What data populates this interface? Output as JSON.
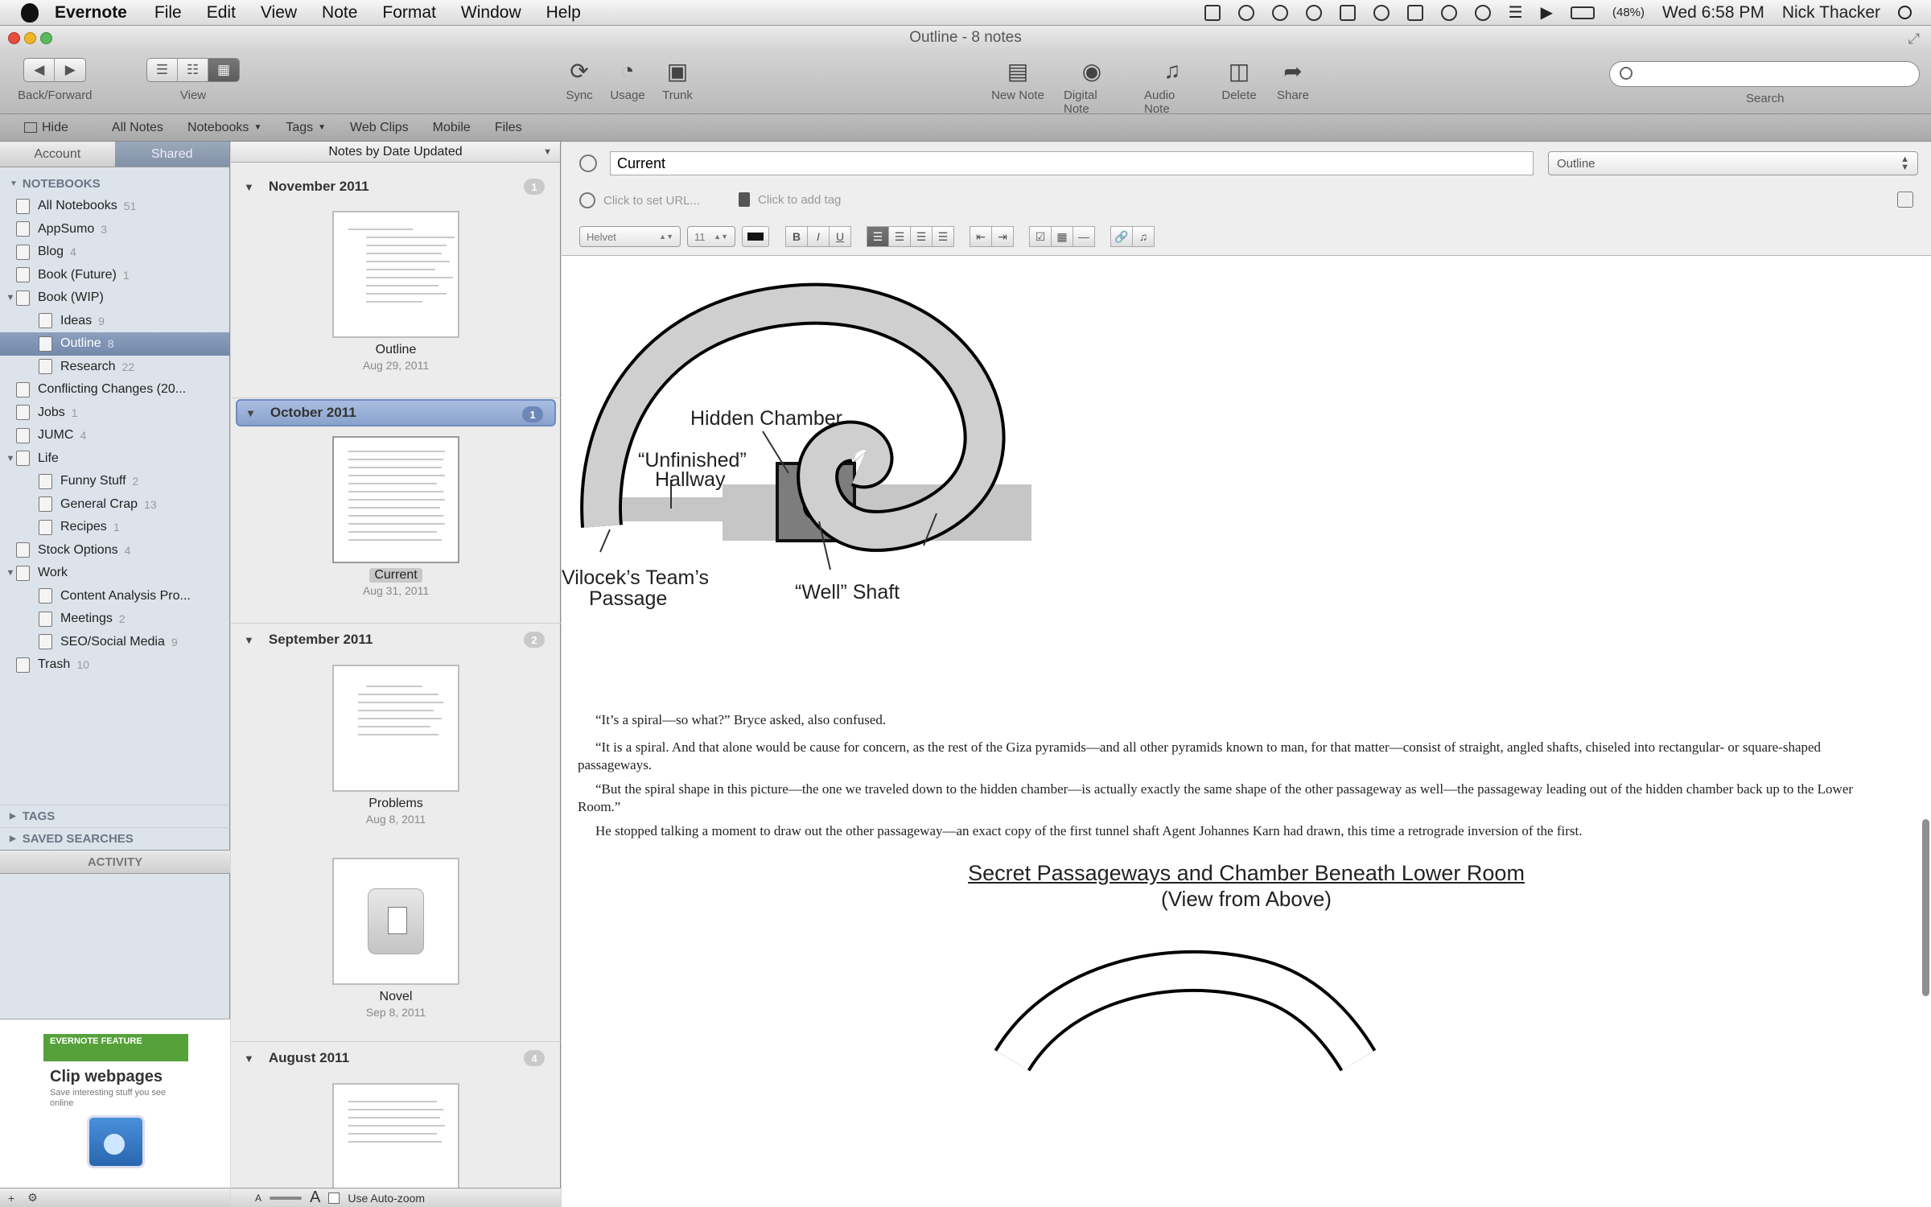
{
  "menubar": {
    "app": "Evernote",
    "items": [
      "File",
      "Edit",
      "View",
      "Note",
      "Format",
      "Window",
      "Help"
    ],
    "battery": "(48%)",
    "clock": "Wed 6:58 PM",
    "user": "Nick Thacker"
  },
  "window": {
    "title": "Outline - 8 notes"
  },
  "toolbar": {
    "back_forward_label": "Back/Forward",
    "view_label": "View",
    "sync_label": "Sync",
    "usage_label": "Usage",
    "trunk_label": "Trunk",
    "new_note_label": "New Note",
    "digital_label": "Digital Note",
    "audio_label": "Audio Note",
    "delete_label": "Delete",
    "share_label": "Share",
    "search_label": "Search",
    "search_placeholder": ""
  },
  "navbar": {
    "hide": "Hide",
    "all_notes": "All Notes",
    "notebooks": "Notebooks",
    "tags": "Tags",
    "web_clips": "Web Clips",
    "mobile": "Mobile",
    "files": "Files"
  },
  "sidebar": {
    "tab_account": "Account",
    "tab_shared": "Shared",
    "notebooks_heading": "NOTEBOOKS",
    "items": [
      {
        "label": "All Notebooks",
        "count": "51"
      },
      {
        "label": "AppSumo",
        "count": "3"
      },
      {
        "label": "Blog",
        "count": "4"
      },
      {
        "label": "Book (Future)",
        "count": "1"
      },
      {
        "label": "Book (WIP)",
        "count": ""
      },
      {
        "label": "Ideas",
        "count": "9"
      },
      {
        "label": "Outline",
        "count": "8"
      },
      {
        "label": "Research",
        "count": "22"
      },
      {
        "label": "Conflicting Changes (20...",
        "count": ""
      },
      {
        "label": "Jobs",
        "count": "1"
      },
      {
        "label": "JUMC",
        "count": "4"
      },
      {
        "label": "Life",
        "count": ""
      },
      {
        "label": "Funny Stuff",
        "count": "2"
      },
      {
        "label": "General Crap",
        "count": "13"
      },
      {
        "label": "Recipes",
        "count": "1"
      },
      {
        "label": "Stock Options",
        "count": "4"
      },
      {
        "label": "Work",
        "count": ""
      },
      {
        "label": "Content Analysis Pro...",
        "count": ""
      },
      {
        "label": "Meetings",
        "count": "2"
      },
      {
        "label": "SEO/Social Media",
        "count": "9"
      },
      {
        "label": "Trash",
        "count": "10"
      }
    ],
    "tags_heading": "TAGS",
    "saved_heading": "SAVED SEARCHES",
    "activity": "ACTIVITY",
    "promo": {
      "flag": "EVERNOTE FEATURE",
      "title": "Clip webpages",
      "desc": "Save interesting stuff you see online"
    }
  },
  "notelist": {
    "sort_label": "Notes by Date Updated",
    "months": [
      {
        "label": "November 2011",
        "count": "1"
      },
      {
        "label": "October 2011",
        "count": "1"
      },
      {
        "label": "September 2011",
        "count": "2"
      },
      {
        "label": "August 2011",
        "count": "4"
      }
    ],
    "notes": [
      {
        "title": "Outline",
        "date": "Aug 29, 2011"
      },
      {
        "title": "Current",
        "date": "Aug 31, 2011"
      },
      {
        "title": "Problems",
        "date": "Aug 8, 2011"
      },
      {
        "title": "Novel",
        "date": "Sep 8, 2011"
      }
    ],
    "zoom_label": "Use Auto-zoom"
  },
  "editor": {
    "title": "Current",
    "notebook": "Outline",
    "url_placeholder": "Click to set URL...",
    "tag_placeholder": "Click to add tag",
    "font": "Helvet",
    "size": "11",
    "fmt_bold": "B",
    "fmt_italic": "I",
    "fmt_underline": "U"
  },
  "diagram": {
    "hidden_chamber": "Hidden Chamber",
    "unfinished_1": "“Unfinished”",
    "unfinished_2": "Hallway",
    "vilocek_1": "Vilocek’s Team’s",
    "vilocek_2": "Passage",
    "well_shaft": "“Well” Shaft"
  },
  "body": {
    "p1": "“It’s a spiral—so what?” Bryce asked, also confused.",
    "p2": "“It is a spiral. And that alone would be cause for concern, as the rest of the Giza pyramids—and all other pyramids known to man, for that matter—consist of straight, angled shafts, chiseled into rectangular- or square-shaped passageways.",
    "p3": "“But the spiral shape in this picture—the one we traveled down to the hidden chamber—is actually exactly the same shape of the other passageway as well—the passageway leading out of the hidden chamber back up to the Lower Room.”",
    "p4": "He stopped talking a moment to draw out the other passageway—an exact copy of the first tunnel shaft Agent Johannes Karn had drawn, this time a retrograde inversion of the first.",
    "caption_title": "Secret Passageways and Chamber Beneath Lower Room",
    "caption_sub": "(View from Above)"
  }
}
